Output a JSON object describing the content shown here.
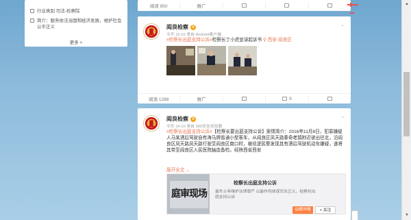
{
  "left_card": {
    "industry": "行业类别 司法-检察院",
    "intro": "简介：服务依法治国和经济发展，维护社会公平正义",
    "more": "更多 >"
  },
  "post0_toolbar": {
    "read": "阅读 850",
    "forward": "推广",
    "comment": "",
    "like": ""
  },
  "post1": {
    "name": "阎良检察",
    "meta": "今天 15:10 来自 Android客户端",
    "tag1": "#检察长出庭支持公诉#",
    "text_mid": "检察长丁小虎宣读起诉书",
    "location": "西安·阎良区",
    "toolbar": {
      "read": "阅读 1288",
      "forward": "推广",
      "comment": "9",
      "like": ""
    }
  },
  "post2": {
    "name": "阎良检察",
    "meta": "今天 14:10 来自 360安全浏览器",
    "tag": "#检察长出庭支持公诉#",
    "text": "【检察长要出庭支持公诉】案情简介：2016年11月8日，犯罪嫌疑人马某酒后驾驶自有海马牌普通小型客车，从阎良区凤天路秦奇老镇附近驶出往北，沿阎良区凤天路凤天路行驶至阎良区南口时，被巡逻民警发现其有酒后驾驶机动车嫌疑，遂将其带至阎良区人民医院抽血备检。经陕西省西安",
    "expand": "展开全文 ⌄",
    "link_title": "检察长出庭支持公诉",
    "link_desc": "最先士帝维护法律尊严 以最作到体现司法正义，检察长出庭支持公诉",
    "btn_view": "话题详情",
    "btn_follow": "+ 关注",
    "img_text": "庭审现场"
  },
  "colors": {
    "accent": "#eb7350",
    "button": "#ff8140",
    "badge": "#f3a512"
  },
  "icons": [
    "emblem-icon",
    "verified-badge-icon",
    "forward-icon",
    "comment-icon",
    "like-icon",
    "location-icon",
    "dropdown-icon"
  ]
}
